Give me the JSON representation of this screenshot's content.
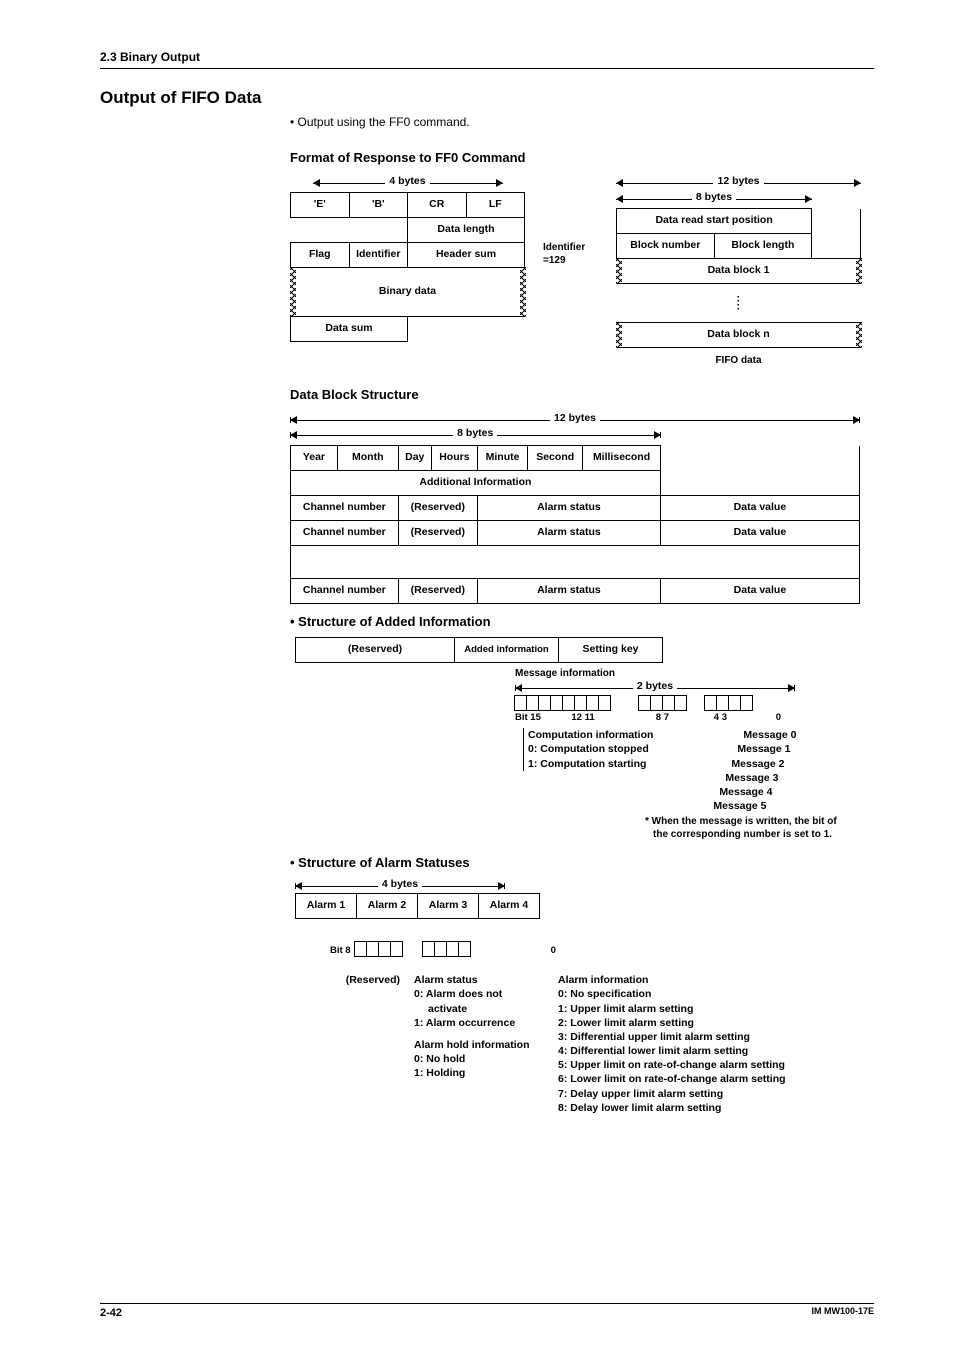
{
  "header": {
    "crumb": "2.3  Binary Output"
  },
  "title": "Output of FIFO Data",
  "intro_bullet": "Output using the FF0 command.",
  "h_format": "Format of Response to FF0 Command",
  "fig1": {
    "four_bytes": "4 bytes",
    "twelve_bytes": "12 bytes",
    "eight_bytes": "8 bytes",
    "row1": [
      "'E'",
      "'B'",
      "CR",
      "LF"
    ],
    "data_length": "Data length",
    "row3": [
      "Flag",
      "Identifier",
      "Header sum"
    ],
    "binary_data": "Binary data",
    "data_sum": "Data sum",
    "id129": "Identifier =129",
    "right": {
      "read_pos": "Data read start position",
      "block_num": "Block number",
      "block_len": "Block length",
      "block1": "Data block 1",
      "blockn": "Data block n",
      "fifo": "FIFO data"
    }
  },
  "h_block": "Data Block Structure",
  "fig2": {
    "twelve": "12 bytes",
    "eight": "8 bytes",
    "time": [
      "Year",
      "Month",
      "Day",
      "Hours",
      "Minute",
      "Second",
      "Millisecond"
    ],
    "addinfo": "Additional Information",
    "chn": "Channel number",
    "res": "(Reserved)",
    "alarm": "Alarm status",
    "val": "Data value"
  },
  "h_added": "Structure of Added Information",
  "fig3": {
    "reserved": "(Reserved)",
    "added": "Added information",
    "setting": "Setting key",
    "msginfo": "Message information",
    "two": "2 bytes",
    "bit15": "Bit 15",
    "t1211": "12 11",
    "t87": "8 7",
    "t43": "4 3",
    "t0": "0",
    "comp1": "Computation information",
    "comp2": "0: Computation stopped",
    "comp3": "1: Computation starting",
    "msgs": [
      "Message 0",
      "Message 1",
      "Message 2",
      "Message 3",
      "Message 4",
      "Message 5"
    ],
    "note1": "* When the message is written, the bit of",
    "note2": "the corresponding number is set to 1."
  },
  "h_alarm": "Structure of Alarm Statuses",
  "fig4": {
    "four": "4 bytes",
    "cols": [
      "Alarm 1",
      "Alarm 2",
      "Alarm 3",
      "Alarm 4"
    ],
    "bit8": "Bit 8",
    "t0": "0",
    "reserved": "(Reserved)",
    "as_title": "Alarm status",
    "as1": "0: Alarm does not",
    "as1b": "activate",
    "as2": "1: Alarm occurrence",
    "hold_title": "Alarm hold information",
    "hold1": "0: No hold",
    "hold2": "1: Holding",
    "ai_title": "Alarm information",
    "ai": [
      "0: No specification",
      "1: Upper limit alarm setting",
      "2: Lower limit alarm setting",
      "3: Differential upper limit alarm setting",
      "4: Differential lower limit alarm setting",
      "5: Upper limit on rate-of-change alarm setting",
      "6: Lower limit on rate-of-change alarm setting",
      "7: Delay upper limit alarm setting",
      "8: Delay lower limit alarm setting"
    ]
  },
  "footer": {
    "page": "2-42",
    "doc": "IM MW100-17E"
  }
}
